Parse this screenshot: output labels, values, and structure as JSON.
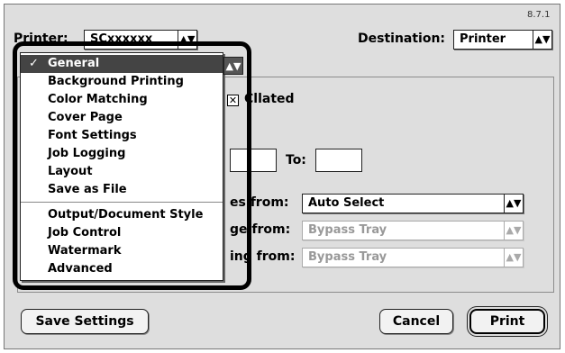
{
  "dialog": {
    "version": "8.7.1",
    "printer_label": "Printer:",
    "printer_value": "SCxxxxxx",
    "destination_label": "Destination:",
    "destination_value": "Printer"
  },
  "menu": {
    "items": [
      {
        "label": "General",
        "selected": true
      },
      {
        "label": "Background Printing"
      },
      {
        "label": "Color Matching"
      },
      {
        "label": "Cover Page"
      },
      {
        "label": "Font Settings"
      },
      {
        "label": "Job Logging"
      },
      {
        "label": "Layout"
      },
      {
        "label": "Save as File"
      },
      {
        "label": "Output/Document Style"
      },
      {
        "label": "Job Control"
      },
      {
        "label": "Watermark"
      },
      {
        "label": "Advanced"
      }
    ],
    "check_glyph": "✓"
  },
  "general": {
    "collated_label": "Collated",
    "collated_fragment": "C",
    "collated_rest": "llated",
    "to_label": "To:",
    "paper_rows": [
      {
        "label_fragment": "es from:",
        "value": "Auto Select",
        "enabled": true
      },
      {
        "label_fragment": "ge from:",
        "value": "Bypass Tray",
        "enabled": false
      },
      {
        "label_fragment": "ing from:",
        "value": "Bypass Tray",
        "enabled": false
      }
    ]
  },
  "buttons": {
    "save_settings": "Save Settings",
    "cancel": "Cancel",
    "print": "Print"
  }
}
